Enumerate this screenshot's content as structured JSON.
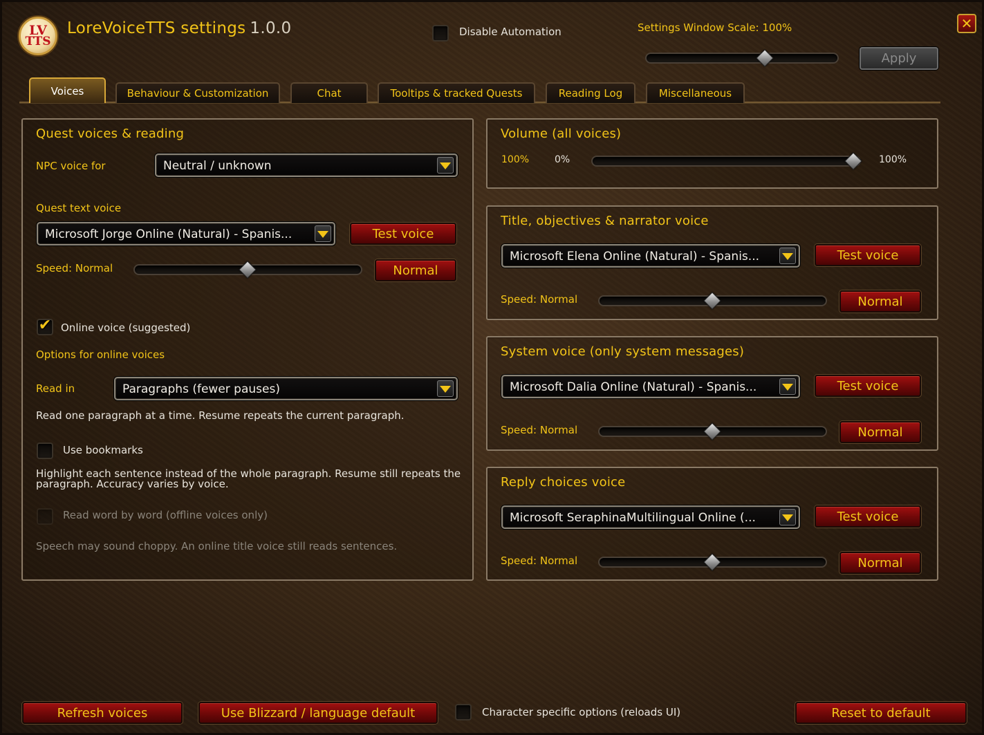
{
  "header": {
    "logo_text_top": "LV",
    "logo_text_bottom": "TTS",
    "title": "LoreVoiceTTS settings",
    "version": "1.0.0",
    "disable_automation_label": "Disable Automation",
    "disable_automation_checked": false,
    "scale_label": "Settings Window Scale: 100%",
    "scale_value_percent": 100,
    "apply_label": "Apply",
    "close_glyph": "✕"
  },
  "tabs": [
    {
      "label": "Voices",
      "active": true
    },
    {
      "label": "Behaviour & Customization",
      "active": false
    },
    {
      "label": "Chat",
      "active": false
    },
    {
      "label": "Tooltips & tracked Quests",
      "active": false
    },
    {
      "label": "Reading Log",
      "active": false
    },
    {
      "label": "Miscellaneous",
      "active": false
    }
  ],
  "quest_panel": {
    "title": "Quest voices & reading",
    "npc_voice_label": "NPC voice for",
    "npc_voice_value": "Neutral / unknown",
    "quest_text_label": "Quest text voice",
    "quest_text_value": "Microsoft Jorge Online (Natural) - Spanis...",
    "test_voice_label": "Test voice",
    "speed_label": "Speed: Normal",
    "speed_button": "Normal",
    "speed_position": 0.5,
    "online_voice_label": "Online voice (suggested)",
    "online_voice_checked": true,
    "options_online_label": "Options for online voices",
    "read_in_label": "Read in",
    "read_in_value": "Paragraphs (fewer pauses)",
    "read_in_desc": "Read one paragraph at a time. Resume repeats the current paragraph.",
    "bookmarks_label": "Use bookmarks",
    "bookmarks_checked": false,
    "bookmarks_desc_1": "Highlight each sentence instead of the whole paragraph. Resume still repeats the",
    "bookmarks_desc_2": "paragraph. Accuracy varies by voice.",
    "word_by_word_label": "Read word by word (offline voices only)",
    "word_by_word_desc": "Speech may sound choppy. An online title voice still reads sentences."
  },
  "volume_panel": {
    "title": "Volume (all voices)",
    "current": "100%",
    "min": "0%",
    "max": "100%",
    "value_percent": 100
  },
  "title_panel": {
    "title": "Title, objectives & narrator voice",
    "voice_value": "Microsoft Elena Online (Natural) - Spanis...",
    "test_voice_label": "Test voice",
    "speed_label": "Speed: Normal",
    "speed_button": "Normal",
    "speed_position": 0.5
  },
  "system_panel": {
    "title": "System voice (only system messages)",
    "voice_value": "Microsoft Dalia Online (Natural) - Spanis...",
    "test_voice_label": "Test voice",
    "speed_label": "Speed: Normal",
    "speed_button": "Normal",
    "speed_position": 0.5
  },
  "reply_panel": {
    "title": "Reply choices voice",
    "voice_value": "Microsoft SeraphinaMultilingual Online (...",
    "test_voice_label": "Test voice",
    "speed_label": "Speed: Normal",
    "speed_button": "Normal",
    "speed_position": 0.5
  },
  "footer": {
    "refresh_label": "Refresh voices",
    "blizzard_default_label": "Use Blizzard / language default",
    "character_specific_label": "Character specific options (reloads UI)",
    "character_specific_checked": false,
    "reset_label": "Reset to default"
  },
  "colors": {
    "gold_text": "#f2c418",
    "button_red": "#8a0c0a",
    "panel_border": "#8a7a66"
  }
}
